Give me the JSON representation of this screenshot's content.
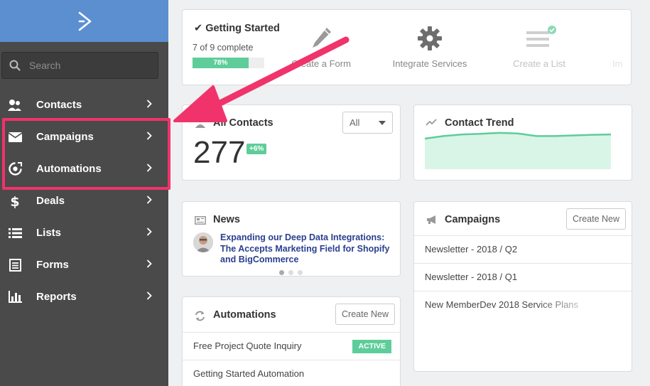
{
  "sidebar": {
    "search": {
      "placeholder": "Search"
    },
    "items": [
      {
        "label": "Contacts",
        "icon": "contacts-icon"
      },
      {
        "label": "Campaigns",
        "icon": "envelope-icon"
      },
      {
        "label": "Automations",
        "icon": "automation-icon"
      },
      {
        "label": "Deals",
        "icon": "dollar-icon"
      },
      {
        "label": "Lists",
        "icon": "list-icon"
      },
      {
        "label": "Forms",
        "icon": "form-icon"
      },
      {
        "label": "Reports",
        "icon": "bar-chart-icon"
      }
    ]
  },
  "getting_started": {
    "title": "Getting Started",
    "subtitle": "7 of 9 complete",
    "progress_label": "78%",
    "progress": 78,
    "steps": [
      {
        "label": "Create a Form",
        "icon": "pencil-icon"
      },
      {
        "label": "Integrate Services",
        "icon": "gear-icon"
      },
      {
        "label": "Create a List",
        "icon": "list-lines-icon"
      },
      {
        "label": "Im",
        "icon": "import-icon"
      }
    ]
  },
  "contacts_card": {
    "title": "All Contacts",
    "filter": "All",
    "count": "277",
    "change": "+6%"
  },
  "trend_card": {
    "title": "Contact Trend",
    "trend_values": [
      10,
      10.8,
      11.3,
      11.5,
      11.8,
      11.6,
      10.8,
      10.8,
      11.0,
      11.2,
      11.3
    ]
  },
  "news_card": {
    "title": "News",
    "headline": "Expanding our Deep Data Integrations: The Accepts Marketing Field for Shopify and BigCommerce"
  },
  "campaigns_card": {
    "title": "Campaigns",
    "button": "Create New",
    "items": [
      "Newsletter - 2018 / Q2",
      "Newsletter - 2018 / Q1",
      "New MemberDev 2018 Service Plans"
    ]
  },
  "automations_card": {
    "title": "Automations",
    "button": "Create New",
    "items": [
      {
        "name": "Free Project Quote Inquiry",
        "status": "ACTIVE"
      },
      {
        "name": "Getting Started Automation",
        "status": ""
      }
    ]
  },
  "colors": {
    "sidebar": "#4a4a4a",
    "logo_bar": "#5b8fd0",
    "accent_green": "#5ecd9a",
    "highlight_pink": "#f0336b",
    "link_blue": "#2a3f8f"
  }
}
